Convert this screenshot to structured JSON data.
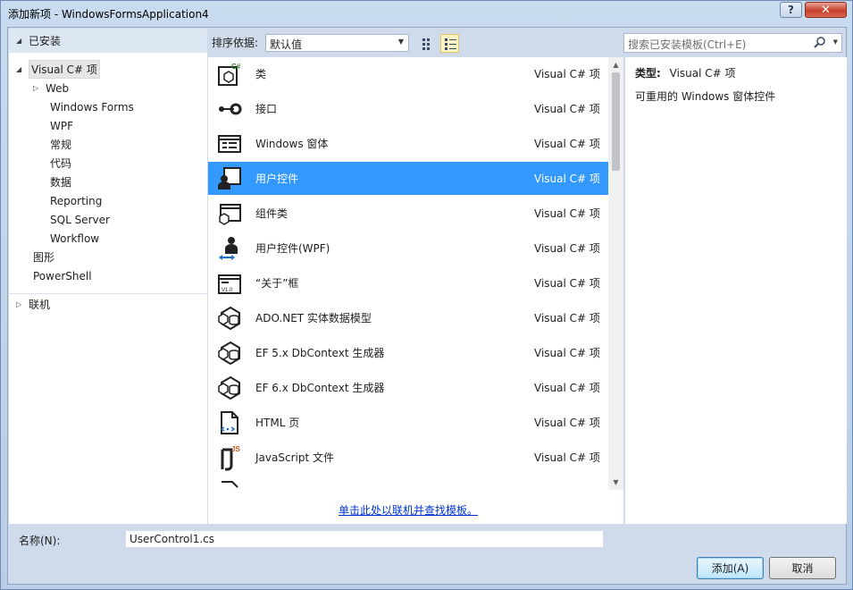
{
  "window": {
    "title": "添加新项 - WindowsFormsApplication4",
    "help_label": "?",
    "close_label": "✕"
  },
  "left_panel": {
    "installed_label": "已安装",
    "tree": [
      {
        "label": "Visual C# 项",
        "expanded": true,
        "selected": true
      },
      {
        "label": "Web",
        "expandable": true
      },
      {
        "label": "Windows Forms"
      },
      {
        "label": "WPF"
      },
      {
        "label": "常规"
      },
      {
        "label": "代码"
      },
      {
        "label": "数据"
      },
      {
        "label": "Reporting"
      },
      {
        "label": "SQL Server"
      },
      {
        "label": "Workflow"
      },
      {
        "label": "图形"
      },
      {
        "label": "PowerShell"
      }
    ],
    "online_label": "联机"
  },
  "toolbar": {
    "sort_label": "排序依据:",
    "sort_value": "默认值",
    "grid_view_icon": "small-icons-view-icon",
    "list_view_icon": "list-view-icon"
  },
  "search": {
    "placeholder": "搜索已安装模板(Ctrl+E)"
  },
  "templates": [
    {
      "name": "类",
      "lang": "Visual C# 项",
      "icon": "class-icon"
    },
    {
      "name": "接口",
      "lang": "Visual C# 项",
      "icon": "interface-icon"
    },
    {
      "name": "Windows 窗体",
      "lang": "Visual C# 项",
      "icon": "windows-form-icon"
    },
    {
      "name": "用户控件",
      "lang": "Visual C# 项",
      "icon": "user-control-icon",
      "selected": true
    },
    {
      "name": "组件类",
      "lang": "Visual C# 项",
      "icon": "component-class-icon"
    },
    {
      "name": "用户控件(WPF)",
      "lang": "Visual C# 项",
      "icon": "wpf-user-control-icon"
    },
    {
      "name": "“关于”框",
      "lang": "Visual C# 项",
      "icon": "about-box-icon"
    },
    {
      "name": "ADO.NET 实体数据模型",
      "lang": "Visual C# 项",
      "icon": "entity-model-icon"
    },
    {
      "name": "EF 5.x DbContext 生成器",
      "lang": "Visual C# 项",
      "icon": "dbcontext-generator-icon"
    },
    {
      "name": "EF 6.x DbContext 生成器",
      "lang": "Visual C# 项",
      "icon": "dbcontext-generator-icon"
    },
    {
      "name": "HTML 页",
      "lang": "Visual C# 项",
      "icon": "html-page-icon"
    },
    {
      "name": "JavaScript 文件",
      "lang": "Visual C# 项",
      "icon": "javascript-file-icon"
    }
  ],
  "online_link": "单击此处以联机并查找模板。",
  "details": {
    "type_label": "类型:",
    "type_value": "Visual C# 项",
    "description": "可重用的 Windows 窗体控件"
  },
  "bottom": {
    "name_label": "名称(N):",
    "name_value": "UserControl1.cs",
    "add_label": "添加(A)",
    "cancel_label": "取消"
  },
  "colors": {
    "selection": "#3399ff",
    "link": "#0033cc",
    "frame": "#cfdaea"
  }
}
